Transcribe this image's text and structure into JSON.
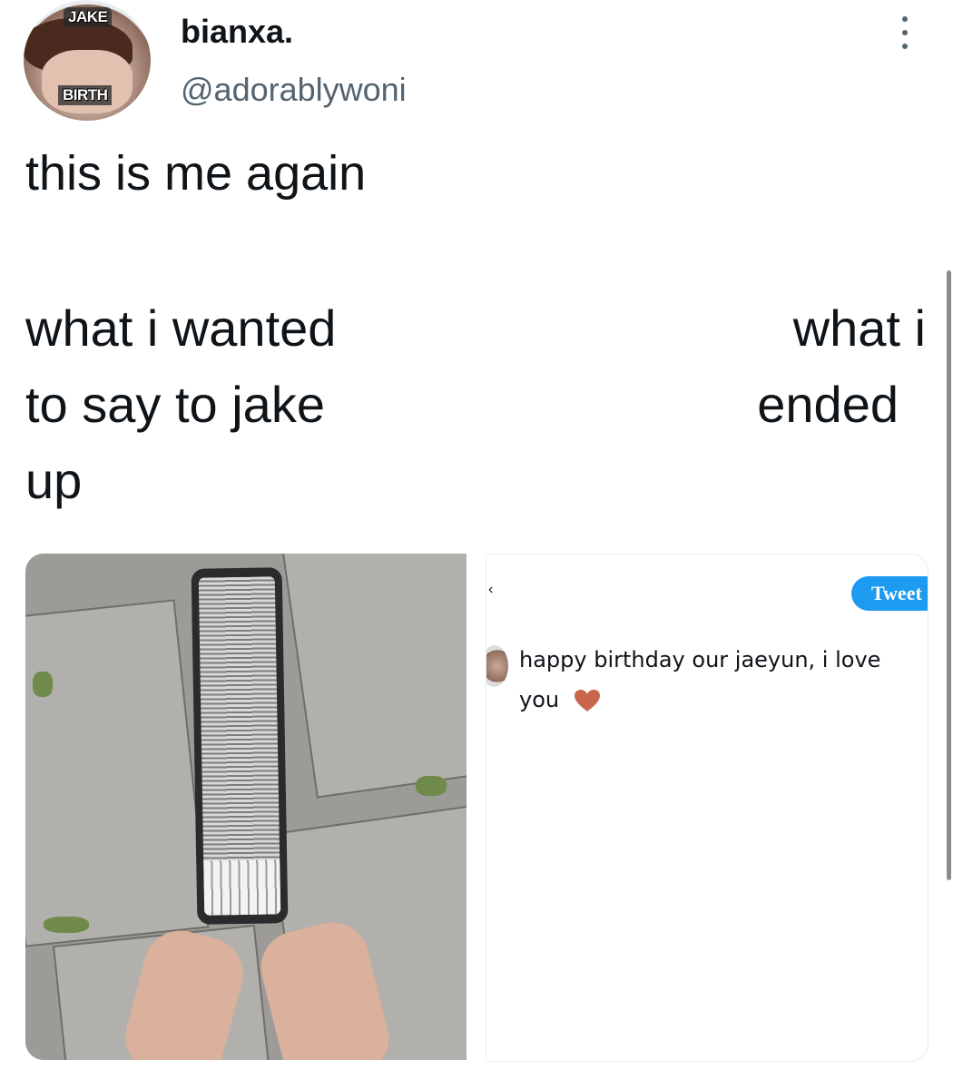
{
  "header": {
    "display_name": "bianxa.",
    "handle": "@adorablywoni",
    "avatar": {
      "top_label": "JAKE",
      "bottom_label": "BIRTH"
    },
    "more_icon": "more-vertical-icon"
  },
  "tweet": {
    "text": "this is me again"
  },
  "meme": {
    "left_caption_lines": [
      "what i wanted",
      "to say to jake",
      "up"
    ],
    "right_caption_lines": [
      "what i",
      "ended"
    ]
  },
  "images": {
    "left": {
      "description_icon": "long-phone-photo"
    },
    "right": {
      "tweet_button_label": "Tweet",
      "reply_text": "happy birthday our jaeyun, i love you",
      "heart_color": "#c8654a",
      "back_icon": "back-chevron-icon"
    }
  },
  "colors": {
    "accent": "#1d9bf0",
    "text": "#0f1419",
    "secondary_text": "#536471"
  }
}
